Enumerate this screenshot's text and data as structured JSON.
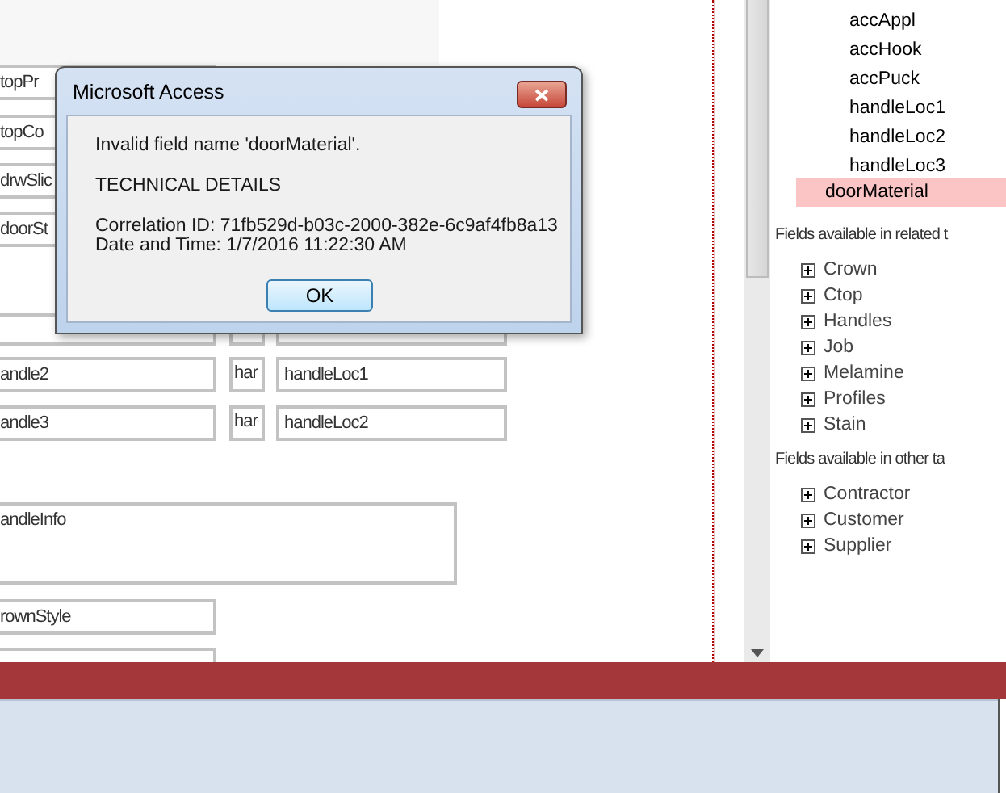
{
  "design_form": {
    "rows": [
      {
        "fields": [
          {
            "kind": "text_box",
            "value": "topPr"
          }
        ]
      },
      {
        "fields": [
          {
            "kind": "text_box",
            "value": "topCo"
          }
        ]
      },
      {
        "fields": [
          {
            "kind": "text_box",
            "value": "drwSlic"
          }
        ]
      },
      {
        "fields": [
          {
            "kind": "text_box",
            "value": "doorSt"
          }
        ]
      },
      {
        "fields": [
          {
            "kind": "text_box"
          },
          {
            "kind": "text_box"
          },
          {
            "kind": "text_box"
          }
        ]
      },
      {
        "fields": [
          {
            "kind": "text_box",
            "value": "andle2"
          },
          {
            "kind": "text_box",
            "value": "har"
          },
          {
            "kind": "text_box",
            "value": "handleLoc1"
          }
        ]
      },
      {
        "fields": [
          {
            "kind": "text_box",
            "value": "andle3"
          },
          {
            "kind": "text_box",
            "value": "har"
          },
          {
            "kind": "text_box",
            "value": "handleLoc2"
          }
        ]
      },
      {
        "fields": [
          {
            "kind": "text_box",
            "value": "andleInfo"
          }
        ]
      },
      {
        "fields": [
          {
            "kind": "text_box",
            "value": "rownStyle"
          }
        ]
      },
      {
        "fields": [
          {
            "kind": "text_box"
          }
        ]
      }
    ]
  },
  "dialog": {
    "title": "Microsoft Access",
    "message": "Invalid field name 'doorMaterial'.",
    "details_heading": "TECHNICAL DETAILS",
    "correlation": "Correlation ID: 71fb529d-b03c-2000-382e-6c9af4fb8a13",
    "date_time": "Date and Time: 1/7/2016 11:22:30 AM",
    "button": "OK"
  },
  "field_list": {
    "fields": [
      {
        "label": "accAppl",
        "kind": "subfield",
        "selected": false
      },
      {
        "label": "accHook",
        "kind": "subfield",
        "selected": false
      },
      {
        "label": "accPuck",
        "kind": "subfield",
        "selected": false
      },
      {
        "label": "handleLoc1",
        "kind": "subfield",
        "selected": false
      },
      {
        "label": "handleLoc2",
        "kind": "subfield",
        "selected": false
      },
      {
        "label": "handleLoc3",
        "kind": "subfield",
        "selected": false
      },
      {
        "label": "doorMaterial",
        "kind": "field",
        "selected": true
      }
    ],
    "related": {
      "heading": "Fields available in related t",
      "tables": [
        {
          "name": "Crown",
          "expanded": false
        },
        {
          "name": "Ctop",
          "expanded": false
        },
        {
          "name": "Handles",
          "expanded": false
        },
        {
          "name": "Job",
          "expanded": false
        },
        {
          "name": "Melamine",
          "expanded": false
        },
        {
          "name": "Profiles",
          "expanded": false
        },
        {
          "name": "Stain",
          "expanded": false
        }
      ]
    },
    "other": {
      "heading": "Fields available in other ta",
      "tables": [
        {
          "name": "Contractor",
          "expanded": false
        },
        {
          "name": "Customer",
          "expanded": false
        },
        {
          "name": "Supplier",
          "expanded": false
        }
      ]
    }
  }
}
